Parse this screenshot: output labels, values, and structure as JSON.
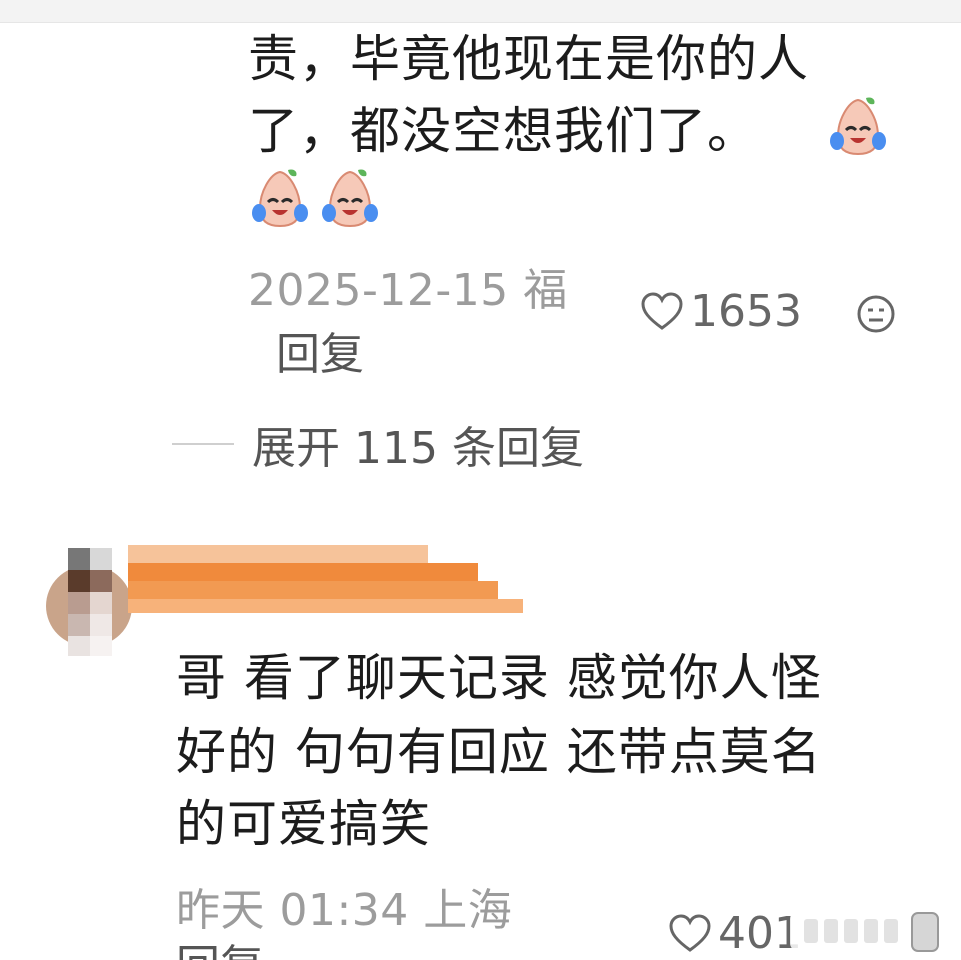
{
  "comment1": {
    "line1": "责，毕竟他现在是你的人",
    "line2": "了，都没空想我们了。",
    "emoji_name": "crying-laughing-sticker-icon",
    "date": "2025-12-15 福",
    "likes": "1653",
    "reply": "回复"
  },
  "thread": {
    "expand": "展开 115 条回复"
  },
  "comment2": {
    "lines": [
      "哥 看了聊天记录 感觉你人怪",
      "好的 句句有回应 还带点莫名",
      "的可爱搞笑"
    ],
    "time": "昨天 01:34",
    "location": "上海",
    "likes": "401",
    "reply": "回复"
  },
  "colors": {
    "meta": "#9c9c9c",
    "username_blur": "#f08a3c"
  }
}
